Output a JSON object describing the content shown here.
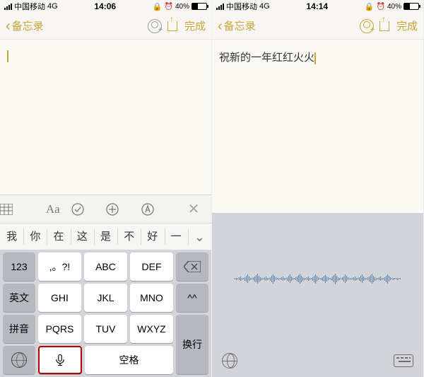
{
  "left": {
    "status": {
      "carrier": "中国移动",
      "net": "4G",
      "time": "14:06",
      "alarm": "⏰",
      "battpct": "40%"
    },
    "nav": {
      "back": "备忘录",
      "done": "完成"
    },
    "note_text": "",
    "suggestions": [
      "我",
      "你",
      "在",
      "这",
      "是",
      "不",
      "好",
      "一"
    ],
    "keys": {
      "r1": [
        "123",
        ",。?!",
        "ABC",
        "DEF"
      ],
      "r2": [
        "英文",
        "GHI",
        "JKL",
        "MNO",
        "^^"
      ],
      "r3": [
        "拼音",
        "PQRS",
        "TUV",
        "WXYZ"
      ],
      "r4": {
        "space": "空格",
        "newline": "换行"
      }
    }
  },
  "right": {
    "status": {
      "carrier": "中国移动",
      "net": "4G",
      "time": "14:14",
      "alarm": "⏰",
      "battpct": "40%"
    },
    "nav": {
      "back": "备忘录",
      "done": "完成"
    },
    "note_text": "祝新的一年红红火火"
  }
}
